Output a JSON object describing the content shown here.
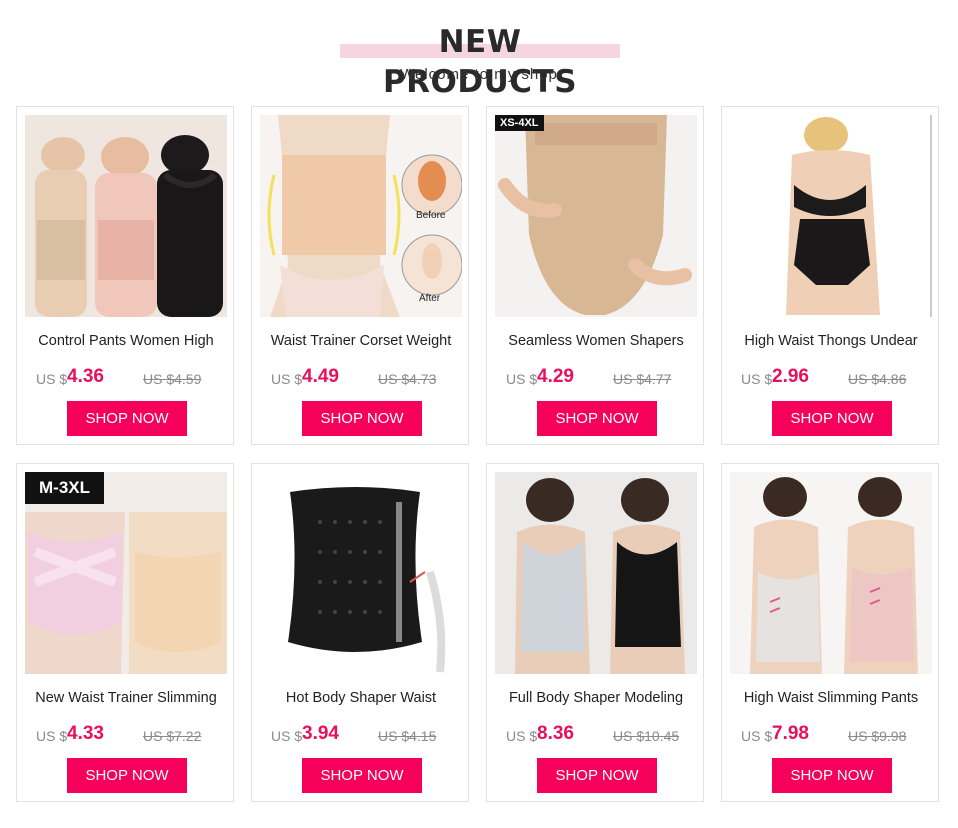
{
  "header": {
    "title": "NEW PRODUCTS",
    "subtitle": "Welcome to my shop"
  },
  "colors": {
    "accent": "#f5005a",
    "price": "#e8105d",
    "title_bar": "#f5d6e0"
  },
  "products": [
    {
      "name": "Control Pants Women High",
      "currency": "US $",
      "price": "4.36",
      "old_price": "US $4.59",
      "button": "SHOP NOW",
      "image": "three-women-bodysuit-image",
      "badge": ""
    },
    {
      "name": "Waist Trainer Corset Weight",
      "currency": "US $",
      "price": "4.49",
      "old_price": "US $4.73",
      "button": "SHOP NOW",
      "image": "waist-trainer-before-after-image",
      "badge": "",
      "inset_labels": [
        "Before",
        "After"
      ]
    },
    {
      "name": "Seamless Women Shapers",
      "currency": "US $",
      "price": "4.29",
      "old_price": "US $4.77",
      "button": "SHOP NOW",
      "image": "high-waist-shaper-image",
      "badge": "XS-4XL"
    },
    {
      "name": "High Waist Thongs Undear",
      "currency": "US $",
      "price": "2.96",
      "old_price": "US $4.86",
      "button": "SHOP NOW",
      "image": "high-waist-thong-image",
      "badge": ""
    },
    {
      "name": "New Waist Trainer Slimming",
      "currency": "US $",
      "price": "4.33",
      "old_price": "US $7.22",
      "button": "SHOP NOW",
      "image": "pink-slimming-brief-image",
      "badge": "M-3XL"
    },
    {
      "name": "Hot Body Shaper Waist",
      "currency": "US $",
      "price": "3.94",
      "old_price": "US $4.15",
      "button": "SHOP NOW",
      "image": "black-corset-image",
      "badge": ""
    },
    {
      "name": "Full Body Shaper Modeling",
      "currency": "US $",
      "price": "8.36",
      "old_price": "US $10.45",
      "button": "SHOP NOW",
      "image": "full-body-shaper-image",
      "badge": ""
    },
    {
      "name": "High Waist Slimming Pants",
      "currency": "US $",
      "price": "7.98",
      "old_price": "US $9.98",
      "button": "SHOP NOW",
      "image": "slimming-pants-image",
      "badge": ""
    }
  ]
}
